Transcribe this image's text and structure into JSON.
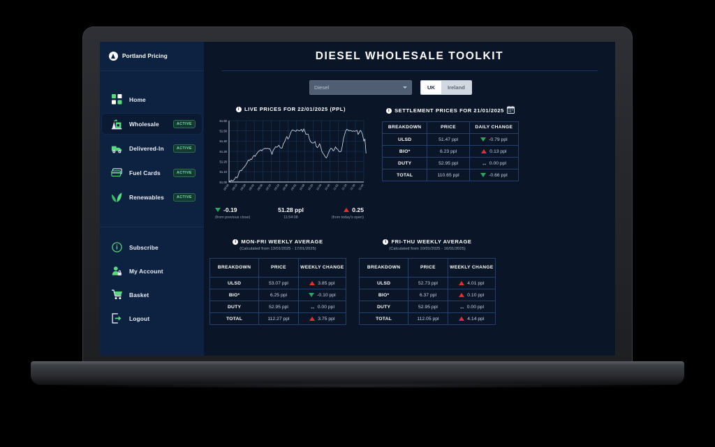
{
  "brand": {
    "name": "Portland Pricing",
    "logo_icon": "portland-logo-icon"
  },
  "sidebar": {
    "top_items": [
      {
        "label": "Home",
        "icon": "grid-icon",
        "badge": ""
      },
      {
        "label": "Wholesale",
        "icon": "oil-pump-icon",
        "badge": "ACTIVE",
        "active": true
      },
      {
        "label": "Delivered-In",
        "icon": "delivery-truck-icon",
        "badge": "ACTIVE"
      },
      {
        "label": "Fuel Cards",
        "icon": "credit-cards-icon",
        "badge": "ACTIVE"
      },
      {
        "label": "Renewables",
        "icon": "leaf-icon",
        "badge": "ACTIVE"
      }
    ],
    "bottom_items": [
      {
        "label": "Subscribe",
        "icon": "info-circle-icon"
      },
      {
        "label": "My Account",
        "icon": "user-lock-icon"
      },
      {
        "label": "Basket",
        "icon": "shopping-cart-icon"
      },
      {
        "label": "Logout",
        "icon": "logout-arrow-icon"
      }
    ]
  },
  "header": {
    "title": "DIESEL WHOLESALE TOOLKIT"
  },
  "controls": {
    "product_select": {
      "value": "Diesel",
      "options": [
        "Diesel"
      ],
      "icon": "chevron-down-icon"
    },
    "region_toggle": {
      "selected": "UK",
      "options": [
        "UK",
        "Ireland"
      ]
    }
  },
  "live": {
    "heading": "LIVE PRICES FOR 22/01/2025 (PPL)",
    "info_icon": "info-icon",
    "prev_close": {
      "value": "-0.19",
      "direction": "down",
      "note": "(from previous close)"
    },
    "current": {
      "value": "51.28 ppl",
      "time": "11:54:08"
    },
    "from_open": {
      "value": "0.25",
      "direction": "up",
      "note": "(from today's open)"
    }
  },
  "settlement": {
    "heading": "SETTLEMENT PRICES FOR 21/01/2025",
    "info_icon": "info-icon",
    "calendar_icon": "calendar-icon",
    "columns": [
      "BREAKDOWN",
      "PRICE",
      "DAILY CHANGE"
    ],
    "rows": [
      {
        "breakdown": "ULSD",
        "price": "51.47 ppl",
        "change": "-0.79 ppl",
        "direction": "down"
      },
      {
        "breakdown": "BIO*",
        "price": "6.23 ppl",
        "change": "0.13 ppl",
        "direction": "up"
      },
      {
        "breakdown": "DUTY",
        "price": "52.95 ppl",
        "change": "0.00 ppl",
        "direction": "flat"
      },
      {
        "breakdown": "TOTAL",
        "price": "110.65 ppl",
        "change": "-0.66 ppl",
        "direction": "down"
      }
    ]
  },
  "weekly_monfri": {
    "heading": "MON-FRI WEEKLY AVERAGE",
    "info_icon": "info-icon",
    "subtitle": "(Calculated from 13/01/2025 - 17/01/2025)",
    "columns": [
      "BREAKDOWN",
      "PRICE",
      "WEEKLY CHANGE"
    ],
    "rows": [
      {
        "breakdown": "ULSD",
        "price": "53.07 ppl",
        "change": "3.85 ppl",
        "direction": "up"
      },
      {
        "breakdown": "BIO*",
        "price": "6.25 ppl",
        "change": "-0.10 ppl",
        "direction": "down"
      },
      {
        "breakdown": "DUTY",
        "price": "52.95 ppl",
        "change": "0.00 ppl",
        "direction": "flat"
      },
      {
        "breakdown": "TOTAL",
        "price": "112.27 ppl",
        "change": "3.75 ppl",
        "direction": "up"
      }
    ]
  },
  "weekly_frithu": {
    "heading": "FRI-THU WEEKLY AVERAGE",
    "info_icon": "info-icon",
    "subtitle": "(Calculated from 10/01/2025 - 16/01/2025)",
    "columns": [
      "BREAKDOWN",
      "PRICE",
      "WEEKLY CHANGE"
    ],
    "rows": [
      {
        "breakdown": "ULSD",
        "price": "52.73 ppl",
        "change": "4.01 ppl",
        "direction": "up"
      },
      {
        "breakdown": "BIO*",
        "price": "6.37 ppl",
        "change": "0.10 ppl",
        "direction": "up"
      },
      {
        "breakdown": "DUTY",
        "price": "52.95 ppl",
        "change": "0.00 ppl",
        "direction": "flat"
      },
      {
        "breakdown": "TOTAL",
        "price": "112.05 ppl",
        "change": "4.14 ppl",
        "direction": "up"
      }
    ]
  },
  "colors": {
    "accent_green": "#5dd882",
    "up_red": "#e03131",
    "down_green": "#2fa360",
    "sidebar_bg": "#0d2140",
    "page_bg": "#0a1628",
    "grid_line": "#1f3a63"
  },
  "chart_data": {
    "type": "line",
    "title": "LIVE PRICES FOR 22/01/2025 (PPL)",
    "xlabel": "",
    "ylabel": "",
    "ylim": [
      51.0,
      51.6
    ],
    "ytick_labels": [
      "51.00",
      "51.10",
      "51.20",
      "51.30",
      "51.40",
      "51.50",
      "51.60"
    ],
    "yticks": [
      51.0,
      51.1,
      51.2,
      51.3,
      51.4,
      51.5,
      51.6
    ],
    "grid": true,
    "legend": "none",
    "line_color": "#dbe4f0",
    "xtick_labels": [
      "08:00",
      "08:14",
      "08:28",
      "08:42",
      "08:56",
      "09:10",
      "09:24",
      "09:38",
      "09:52",
      "10:06",
      "10:20",
      "10:34",
      "10:48",
      "11:02",
      "11:16",
      "11:30",
      "11:44"
    ],
    "x": [
      0,
      1,
      2,
      3,
      4,
      5,
      6,
      7,
      8,
      9,
      10,
      11,
      12,
      13,
      14,
      15,
      16,
      17,
      18,
      19,
      20,
      21,
      22,
      23,
      24,
      25,
      26,
      27,
      28,
      29,
      30,
      31,
      32,
      33,
      34,
      35,
      36,
      37,
      38,
      39,
      40,
      41,
      42,
      43,
      44,
      45,
      46,
      47,
      48,
      49,
      50,
      51,
      52,
      53,
      54,
      55,
      56,
      57,
      58,
      59,
      60,
      61,
      62,
      63,
      64,
      65,
      66,
      67,
      68,
      69,
      70,
      71,
      72,
      73,
      74,
      75,
      76,
      77,
      78,
      79,
      80,
      81,
      82,
      83,
      84,
      85,
      86,
      87,
      88,
      89,
      90,
      91,
      92,
      93,
      94,
      95,
      96,
      97,
      98,
      99,
      100,
      101,
      102,
      103,
      104,
      105,
      106,
      107,
      108,
      109,
      110,
      111,
      112,
      113,
      114,
      115,
      116,
      117,
      118,
      119
    ],
    "y": [
      51.01,
      51.005,
      51.02,
      51.01,
      51.015,
      51.03,
      51.05,
      51.04,
      51.06,
      51.1,
      51.115,
      51.11,
      51.13,
      51.14,
      51.155,
      51.17,
      51.19,
      51.215,
      51.21,
      51.225,
      51.22,
      51.245,
      51.26,
      51.25,
      51.27,
      51.285,
      51.3,
      51.305,
      51.315,
      51.305,
      51.32,
      51.325,
      51.33,
      51.325,
      51.33,
      51.325,
      51.325,
      51.3,
      51.27,
      51.31,
      51.325,
      51.345,
      51.34,
      51.345,
      51.36,
      51.34,
      51.33,
      51.335,
      51.375,
      51.39,
      51.42,
      51.445,
      51.42,
      51.435,
      51.47,
      51.495,
      51.51,
      51.505,
      51.5,
      51.495,
      51.51,
      51.505,
      51.5,
      51.505,
      51.515,
      51.49,
      51.52,
      51.495,
      51.465,
      51.47,
      51.465,
      51.42,
      51.395,
      51.385,
      51.38,
      51.385,
      51.395,
      51.35,
      51.335,
      51.35,
      51.375,
      51.34,
      51.3,
      51.28,
      51.265,
      51.245,
      51.235,
      51.26,
      51.29,
      51.315,
      51.33,
      51.325,
      51.305,
      51.315,
      51.345,
      51.325,
      51.32,
      51.3,
      51.295,
      51.3,
      51.35,
      51.42,
      51.46,
      51.5,
      51.515,
      51.51,
      51.5,
      51.505,
      51.5,
      51.495,
      51.5,
      51.495,
      51.5,
      51.505,
      51.465,
      51.485,
      51.505,
      51.49,
      51.46,
      51.4,
      51.42,
      51.28
    ]
  }
}
